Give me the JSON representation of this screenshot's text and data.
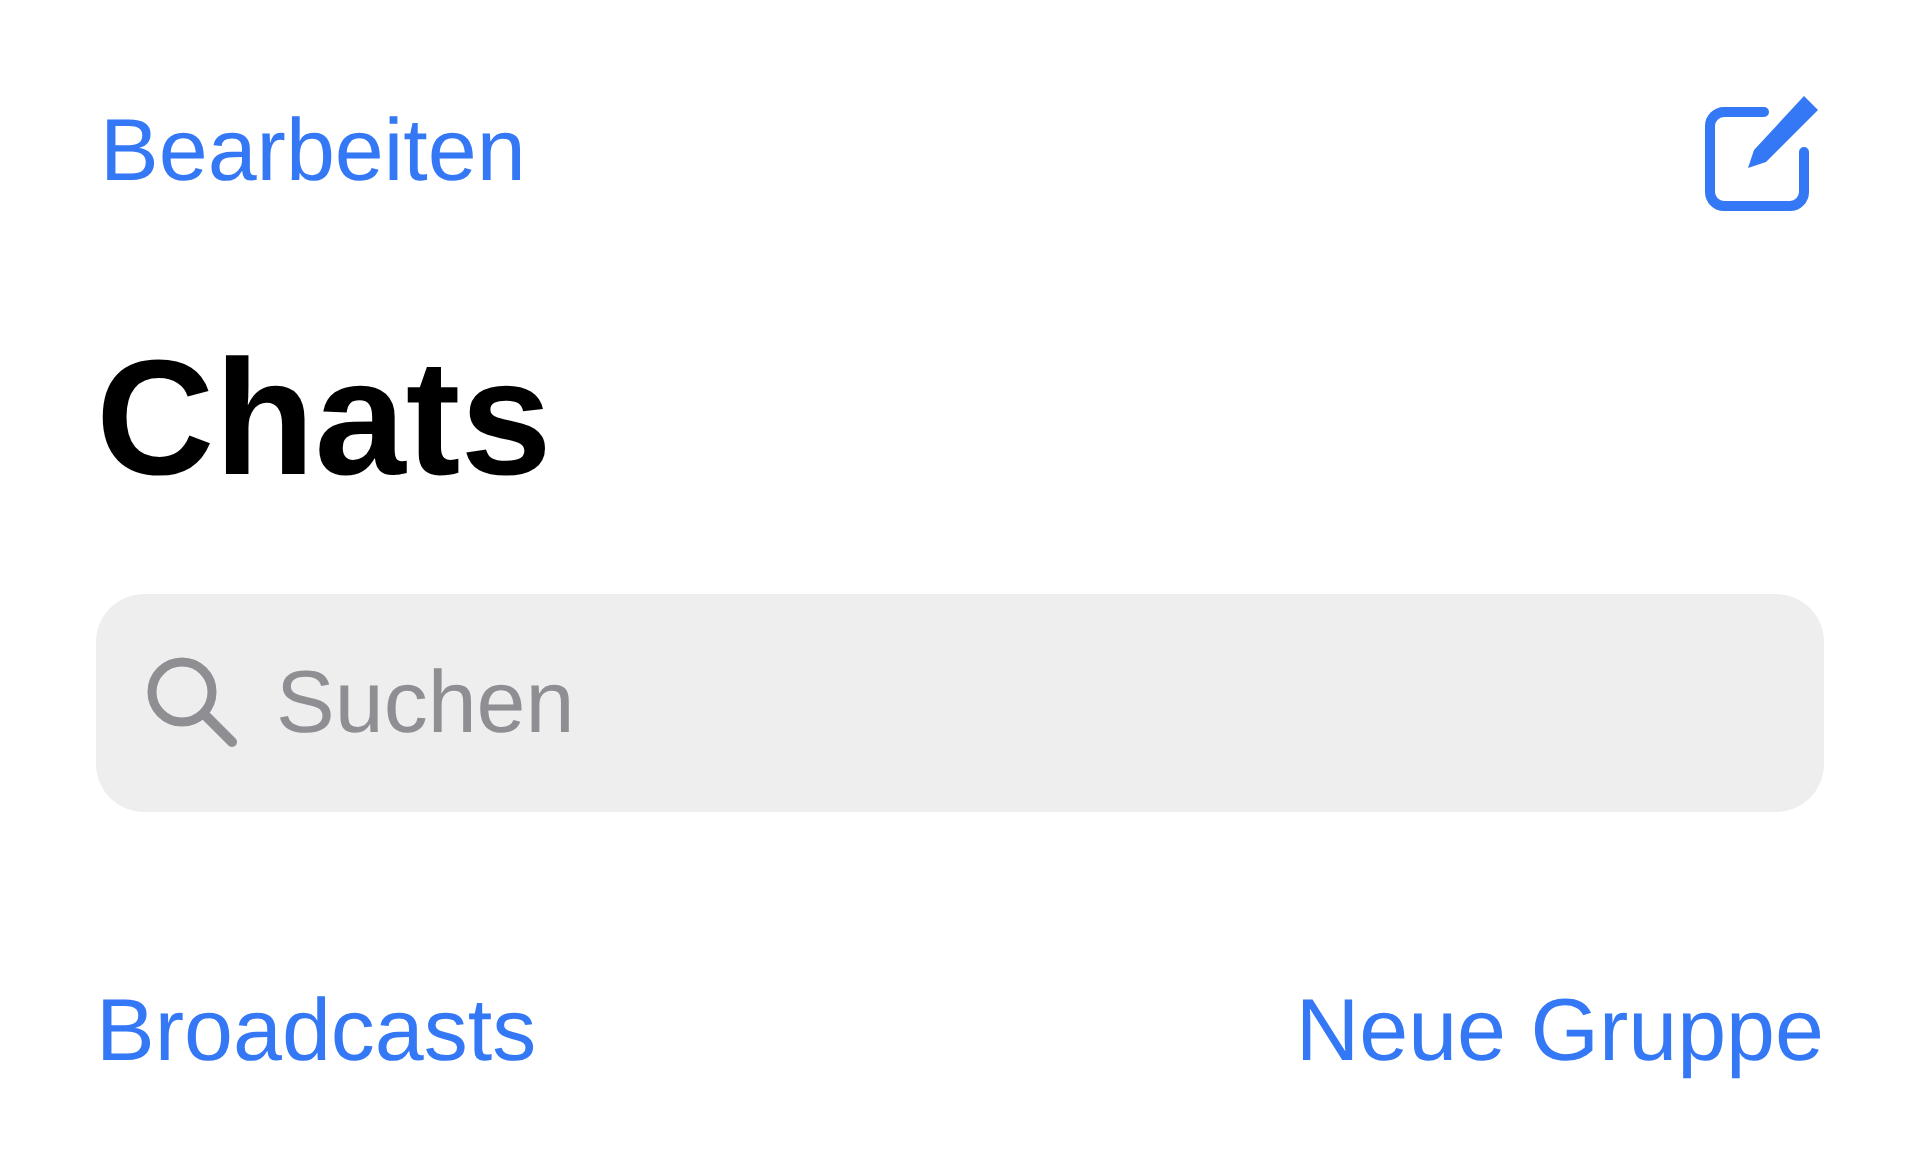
{
  "nav": {
    "edit_label": "Bearbeiten"
  },
  "title": "Chats",
  "search": {
    "placeholder": "Suchen"
  },
  "links": [
    "Broadcasts",
    "Neue Gruppe"
  ]
}
